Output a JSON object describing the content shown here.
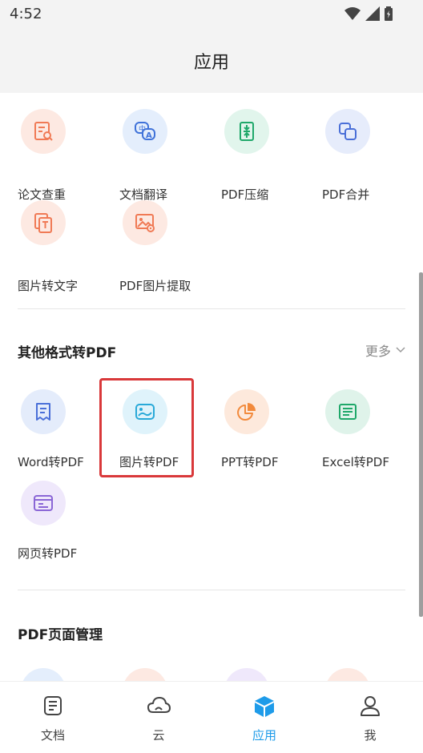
{
  "status": {
    "time": "4:52"
  },
  "header": {
    "title": "应用"
  },
  "top_tools": [
    {
      "label": "论文查重",
      "icon": "document-search-icon"
    },
    {
      "label": "文档翻译",
      "icon": "translate-icon"
    },
    {
      "label": "PDF压缩",
      "icon": "compress-icon"
    },
    {
      "label": "PDF合并",
      "icon": "merge-icon"
    },
    {
      "label": "图片转文字",
      "icon": "image-to-text-icon"
    },
    {
      "label": "PDF图片提取",
      "icon": "image-extract-icon"
    }
  ],
  "section_convert": {
    "title": "其他格式转PDF",
    "more": "更多",
    "items": [
      {
        "label": "Word转PDF",
        "icon": "word-doc-icon"
      },
      {
        "label": "图片转PDF",
        "icon": "picture-icon"
      },
      {
        "label": "PPT转PDF",
        "icon": "pie-chart-icon"
      },
      {
        "label": "Excel转PDF",
        "icon": "spreadsheet-icon"
      },
      {
        "label": "网页转PDF",
        "icon": "webpage-icon"
      }
    ]
  },
  "section_manage": {
    "title": "PDF页面管理"
  },
  "tabbar": [
    {
      "label": "文档",
      "icon": "document-icon"
    },
    {
      "label": "云",
      "icon": "cloud-icon"
    },
    {
      "label": "应用",
      "icon": "cube-icon"
    },
    {
      "label": "我",
      "icon": "person-icon"
    }
  ],
  "colors": {
    "accent": "#1e9be9",
    "highlight": "#d9383a"
  }
}
